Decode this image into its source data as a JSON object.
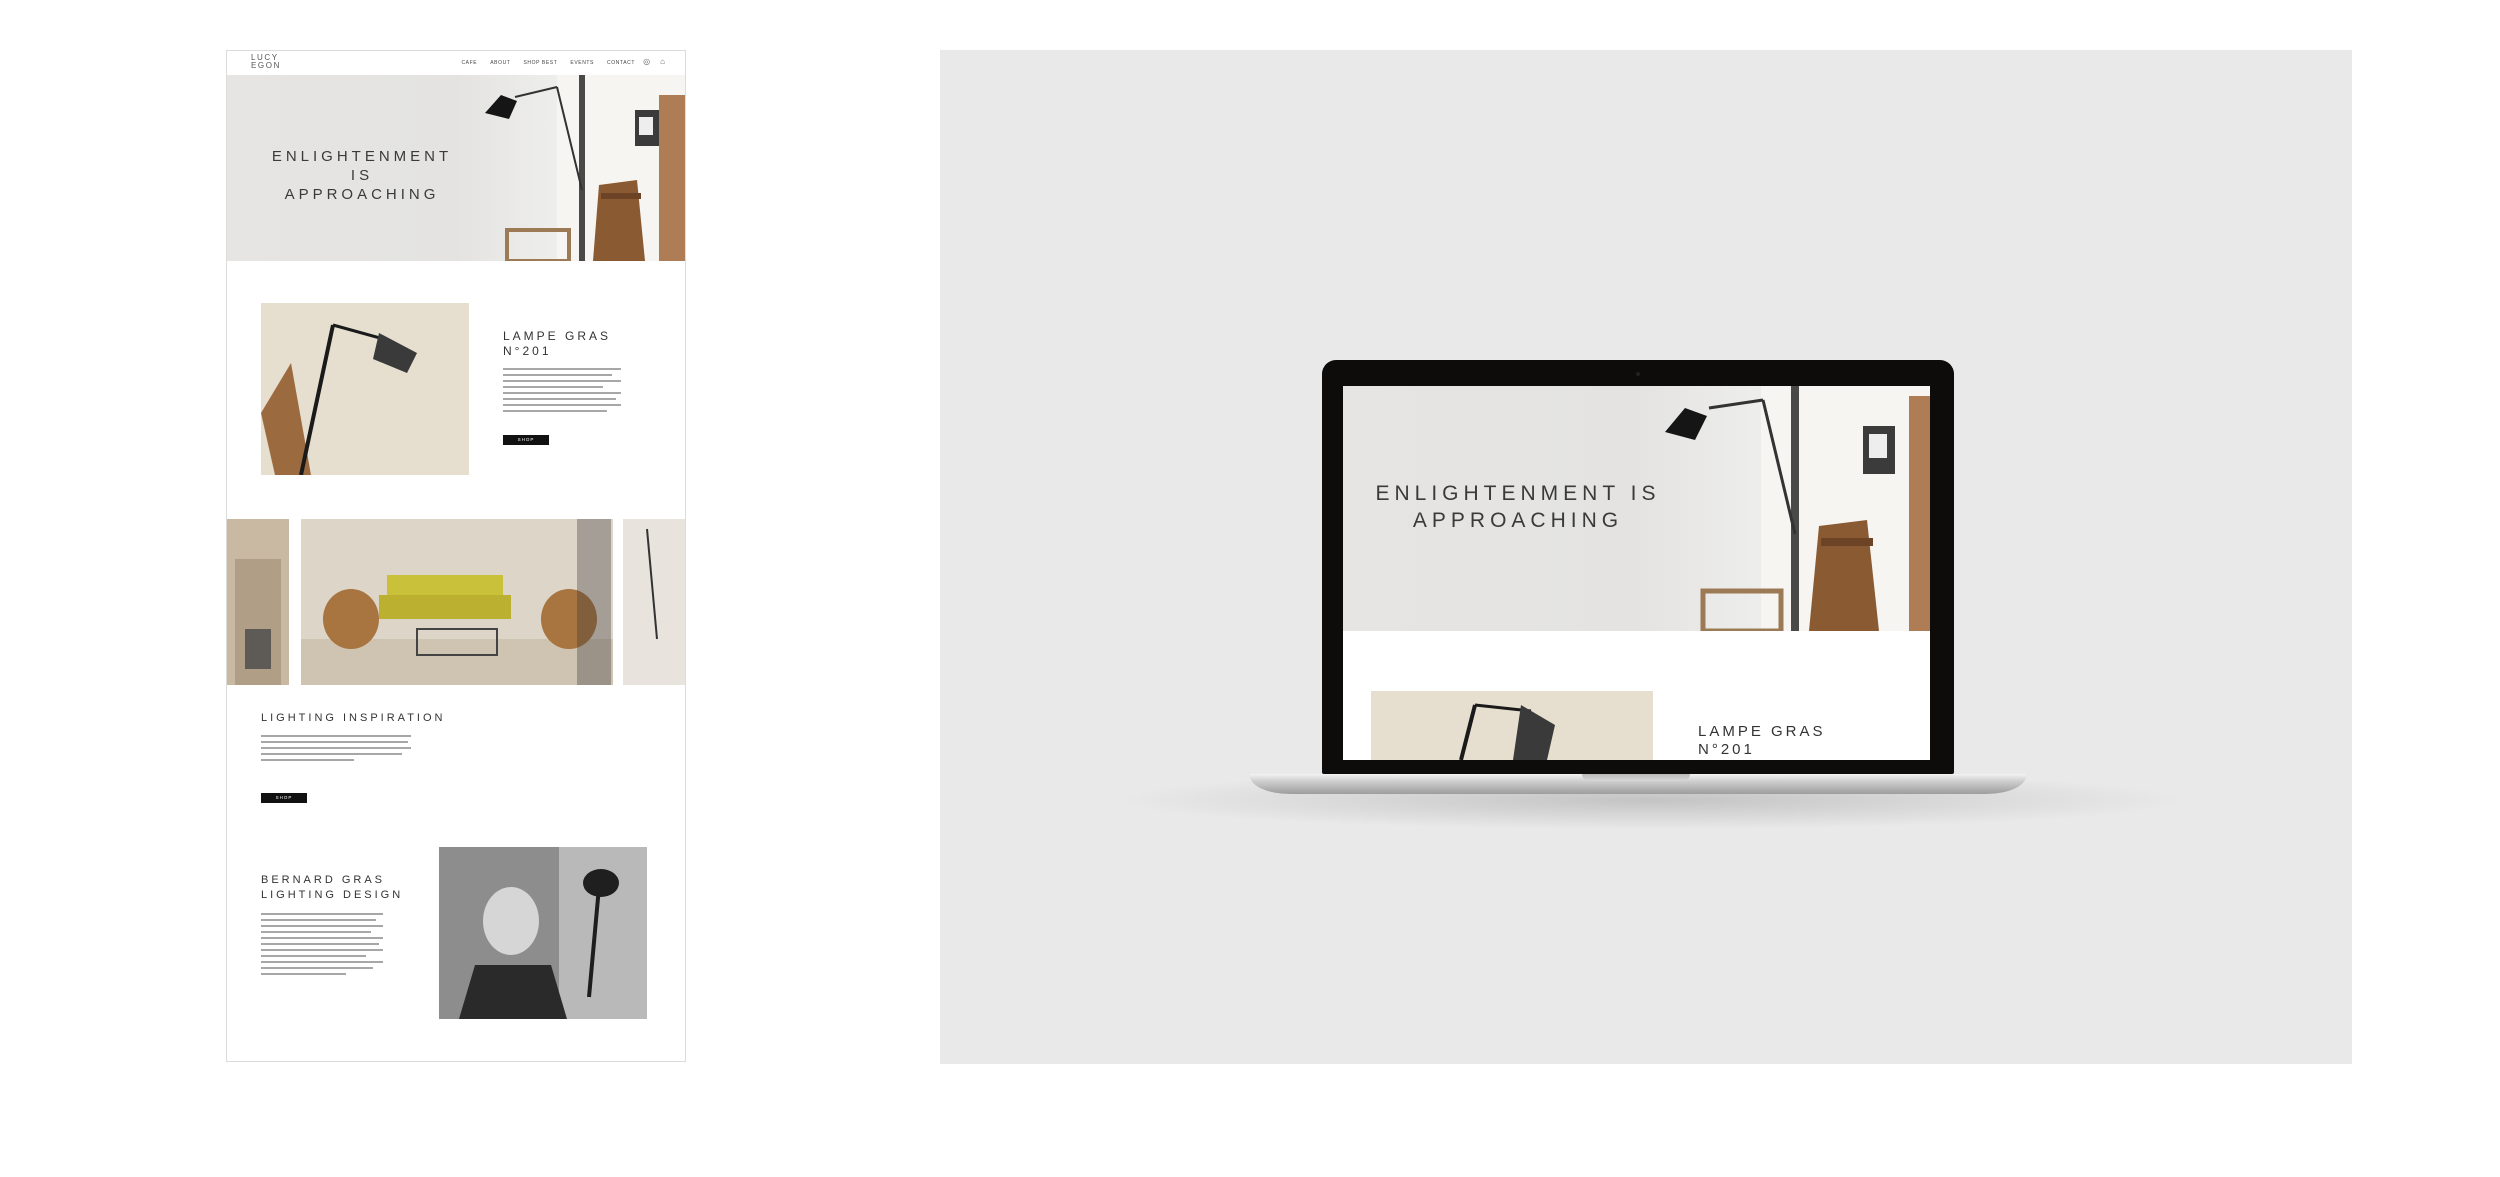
{
  "site": {
    "logo": [
      "LUCY",
      "EGON"
    ],
    "nav": [
      "CAFE",
      "ABOUT",
      "SHOP BEST",
      "EVENTS",
      "CONTACT"
    ],
    "icons": [
      "globe-icon",
      "bag-icon"
    ]
  },
  "hero": {
    "title_line1": "ENLIGHTENMENT IS",
    "title_line2": "APPROACHING"
  },
  "product": {
    "title_line1": "LAMPE GRAS",
    "title_line2": "N°201",
    "button": "SHOP"
  },
  "inspiration": {
    "title": "LIGHTING INSPIRATION",
    "button": "SHOP"
  },
  "designer": {
    "title_line1": "BERNARD GRAS",
    "title_line2": "LIGHTING DESIGN"
  },
  "laptop_screen": {
    "hero_line1": "ENLIGHTENMENT IS",
    "hero_line2": "APPROACHING",
    "product_line1": "LAMPE GRAS",
    "product_line2": "N°201"
  },
  "colors": {
    "background": "#ffffff",
    "presentation": "#e9e9e9",
    "button": "#111111",
    "bezel": "#0d0c0b"
  }
}
